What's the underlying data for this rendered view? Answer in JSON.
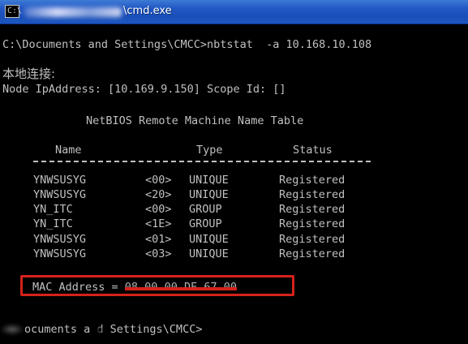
{
  "window": {
    "title_suffix": "\\cmd.exe",
    "title_icon_glyph": "C:\\",
    "icon": "cmd-icon"
  },
  "terminal": {
    "command_line": "C:\\Documents and Settings\\CMCC>nbtstat  -a 10.168.10.108",
    "local_connection": "本地连接:",
    "node_ip_line": "Node IpAddress: [10.169.9.150] Scope Id: []",
    "table_title": "NetBIOS Remote Machine Name Table",
    "headers": {
      "name": "Name",
      "type": "Type",
      "status": "Status"
    },
    "rows": [
      {
        "name": "YNWSUSYG",
        "code": "<00>",
        "type": "UNIQUE",
        "status": "Registered"
      },
      {
        "name": "YNWSUSYG",
        "code": "<20>",
        "type": "UNIQUE",
        "status": "Registered"
      },
      {
        "name": "YN_ITC",
        "code": "<00>",
        "type": "GROUP",
        "status": "Registered"
      },
      {
        "name": "YN_ITC",
        "code": "<1E>",
        "type": "GROUP",
        "status": "Registered"
      },
      {
        "name": "YNWSUSYG",
        "code": "<01>",
        "type": "UNIQUE",
        "status": "Registered"
      },
      {
        "name": "YNWSUSYG",
        "code": "<03>",
        "type": "UNIQUE",
        "status": "Registered"
      }
    ],
    "mac_label": "MAC Address = ",
    "mac_value": "08-00-00-DE-67-00",
    "last_prompt": "ocuments a d Settings\\CMCC>"
  },
  "colors": {
    "terminal_bg": "#000000",
    "terminal_text": "#c0c0c0",
    "titlebar": "#2258c4",
    "highlight": "#d4221a"
  }
}
